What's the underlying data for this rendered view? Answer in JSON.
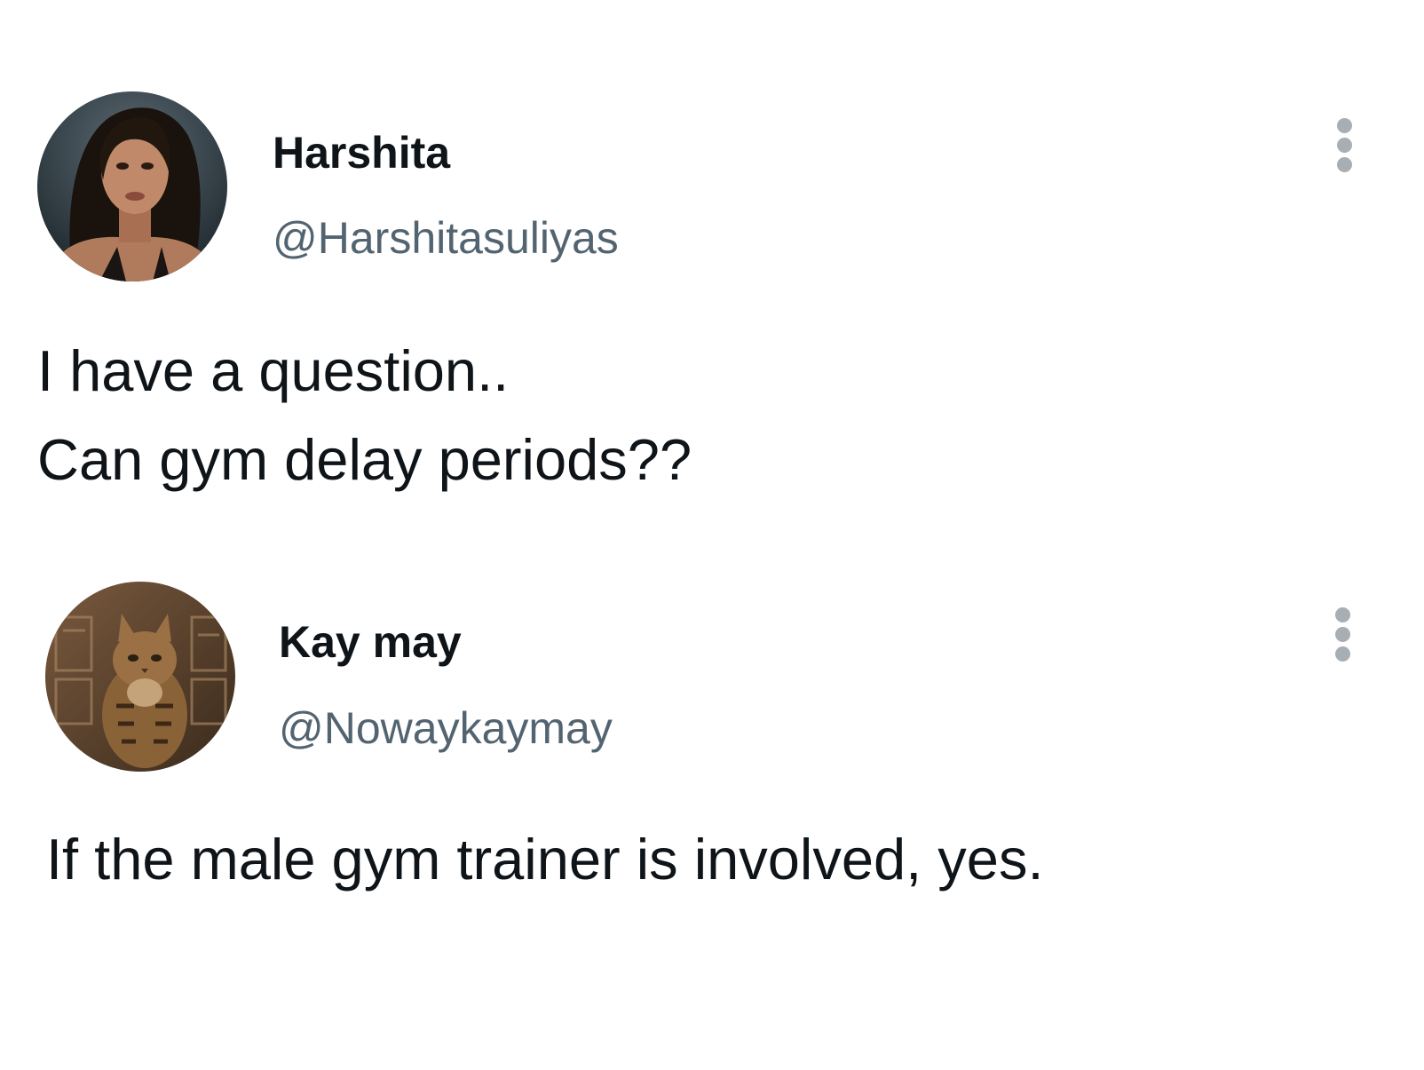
{
  "posts": [
    {
      "display_name": "Harshita",
      "handle": "@Harshitasuliyas",
      "text_lines": [
        "I have a question..",
        "Can gym delay periods??"
      ],
      "avatar_icon": "profile-photo-woman"
    },
    {
      "display_name": "Kay may",
      "handle": "@Nowaykaymay",
      "text_lines": [
        "If the male gym trainer is involved, yes."
      ],
      "avatar_icon": "profile-photo-cat"
    }
  ],
  "colors": {
    "name": "#0f1419",
    "handle": "#536471",
    "menu_dots": "#a7aeb4",
    "background": "#ffffff"
  },
  "icons": {
    "more_menu": "more-vertical-icon"
  }
}
